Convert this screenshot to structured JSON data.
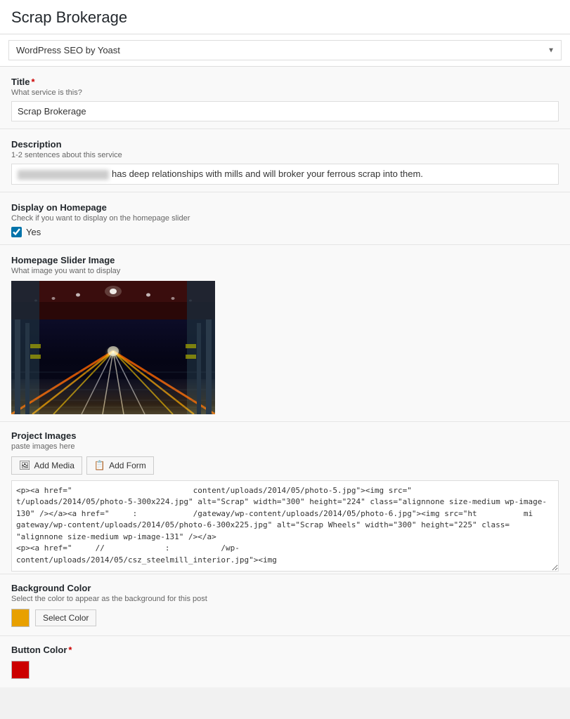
{
  "page": {
    "title": "Scrap Brokerage"
  },
  "seo": {
    "label": "WordPress SEO by Yoast",
    "dropdown_placeholder": "WordPress SEO by Yoast"
  },
  "fields": {
    "title": {
      "label": "Title",
      "required": true,
      "hint": "What service is this?",
      "value": "Scrap Brokerage"
    },
    "description": {
      "label": "Description",
      "hint": "1-2 sentences about this service",
      "visible_text": "has deep relationships with mills and will broker your ferrous scrap into them."
    },
    "display_on_homepage": {
      "label": "Display on Homepage",
      "hint": "Check if you want to display on the homepage slider",
      "checkbox_label": "Yes",
      "checked": true
    },
    "homepage_slider_image": {
      "label": "Homepage Slider Image",
      "hint": "What image you want to display"
    },
    "project_images": {
      "label": "Project Images",
      "hint": "paste images here",
      "add_media_btn": "Add Media",
      "add_form_btn": "Add Form",
      "code_content": "<p><a href=\"                          content/uploads/2014/05/photo-5.jpg\"><img src=\"                     t/uploads/2014/05/photo-5-300x224.jpg\" alt=\"Scrap\" width=\"300\" height=\"224\" class=\"alignnone size-medium wp-image-130\" /></a><a href=\"     :            /gateway/wp-content/uploads/2014/05/photo-6.jpg\"><img src=\"ht          mi    gateway/wp-content/uploads/2014/05/photo-6-300x225.jpg\" alt=\"Scrap Wheels\" width=\"300\" height=\"225\" class=\" alignnone size-medium wp-image-131\" /></a>\n<p><a href=\"     //             :           /wp-\ncontent/uploads/2014/05/csz_steelmill_interior.jpg\"><img"
    },
    "background_color": {
      "label": "Background Color",
      "hint": "Select the color to appear as the background for this post",
      "select_color_btn": "Select Color",
      "color": "#e8a000"
    },
    "button_color": {
      "label": "Button Color",
      "required": true,
      "color": "#cc0000"
    }
  },
  "icons": {
    "checkbox": "✓",
    "add_media": "🖼",
    "add_form": "📋"
  }
}
